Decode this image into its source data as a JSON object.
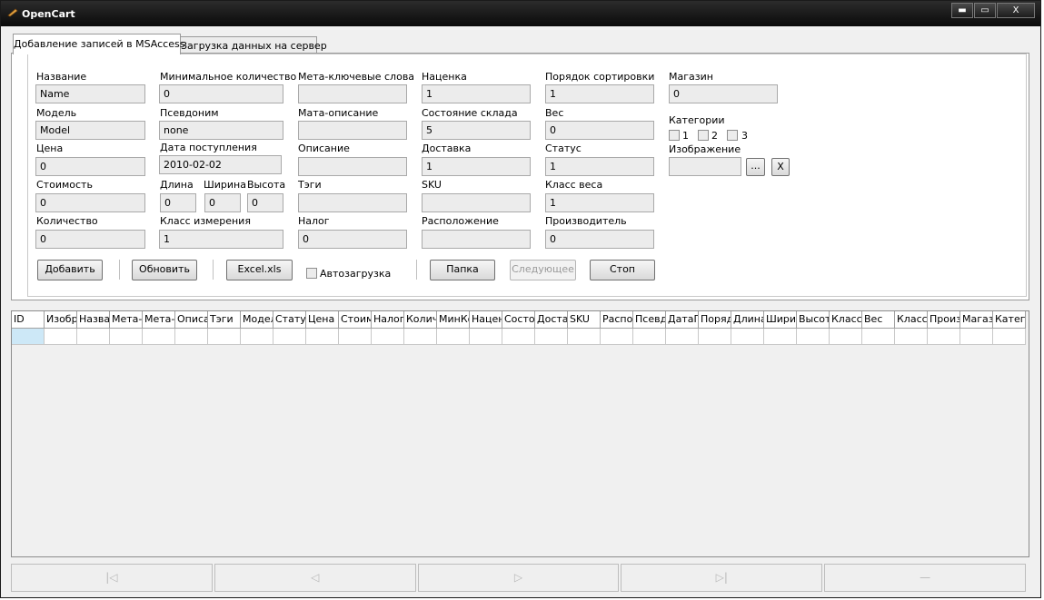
{
  "window": {
    "title": "OpenCart",
    "minimize": "▬",
    "maximize": "▭",
    "close": "X"
  },
  "tabs": [
    {
      "label": "Добавление записей в MSAccess",
      "active": true
    },
    {
      "label": "Загрузка данных на сервер",
      "active": false
    }
  ],
  "form": {
    "name": {
      "label": "Название",
      "value": "Name"
    },
    "model": {
      "label": "Модель",
      "value": "Model"
    },
    "price": {
      "label": "Цена",
      "value": "0"
    },
    "cost": {
      "label": "Стоимость",
      "value": "0"
    },
    "quantity": {
      "label": "Количество",
      "value": "0"
    },
    "min_qty": {
      "label": "Минимальное количество",
      "value": "0"
    },
    "alias": {
      "label": "Псевдоним",
      "value": "none"
    },
    "date_arrival": {
      "label": "Дата поступления",
      "value": "2010-02-02"
    },
    "length": {
      "label": "Длина",
      "value": "0"
    },
    "width": {
      "label": "Ширина",
      "value": "0"
    },
    "height": {
      "label": "Высота",
      "value": "0"
    },
    "measure_class": {
      "label": "Класс измерения",
      "value": "1"
    },
    "meta_keywords": {
      "label": "Мета-ключевые слова",
      "value": ""
    },
    "meta_description": {
      "label": "Мата-описание",
      "value": ""
    },
    "description": {
      "label": "Описание",
      "value": ""
    },
    "tags": {
      "label": "Тэги",
      "value": ""
    },
    "tax": {
      "label": "Налог",
      "value": "0"
    },
    "markup": {
      "label": "Наценка",
      "value": "1"
    },
    "stock_status": {
      "label": "Состояние склада",
      "value": "5"
    },
    "shipping": {
      "label": "Доставка",
      "value": "1"
    },
    "sku": {
      "label": "SKU",
      "value": ""
    },
    "location": {
      "label": "Расположение",
      "value": ""
    },
    "sort_order": {
      "label": "Порядок сортировки",
      "value": "1"
    },
    "weight": {
      "label": "Вес",
      "value": "0"
    },
    "status": {
      "label": "Статус",
      "value": "1"
    },
    "weight_class": {
      "label": "Класс веса",
      "value": "1"
    },
    "manufacturer": {
      "label": "Производитель",
      "value": "0"
    },
    "store": {
      "label": "Магазин",
      "value": "0"
    },
    "categories": {
      "label": "Категории",
      "options": [
        "1",
        "2",
        "3"
      ]
    },
    "image": {
      "label": "Изображение",
      "value": "",
      "browse": "...",
      "clear": "X"
    }
  },
  "buttons": {
    "add": "Добавить",
    "refresh": "Обновить",
    "excel": "Excel.xls",
    "autoload": "Автозагрузка",
    "folder": "Папка",
    "next": "Следующее",
    "stop": "Стоп"
  },
  "grid": {
    "columns": [
      "ID",
      "Изобр",
      "Назва",
      "Мета-к",
      "Мета-с",
      "Описа",
      "Тэги",
      "Модел",
      "Статус",
      "Цена",
      "Стоим",
      "Налог",
      "Количе",
      "МинКо",
      "Наценк",
      "Состоя",
      "Доста",
      "SKU",
      "Распо",
      "Псевд",
      "ДатаП",
      "Поряд",
      "Длина",
      "Ширин",
      "Высот",
      "Класс",
      "Вес",
      "Класс",
      "Произ",
      "Магаз",
      "Катего"
    ]
  },
  "navigator": {
    "first": "|◁",
    "prev": "◁",
    "next": "▷",
    "last": "▷|",
    "blank": "—"
  }
}
